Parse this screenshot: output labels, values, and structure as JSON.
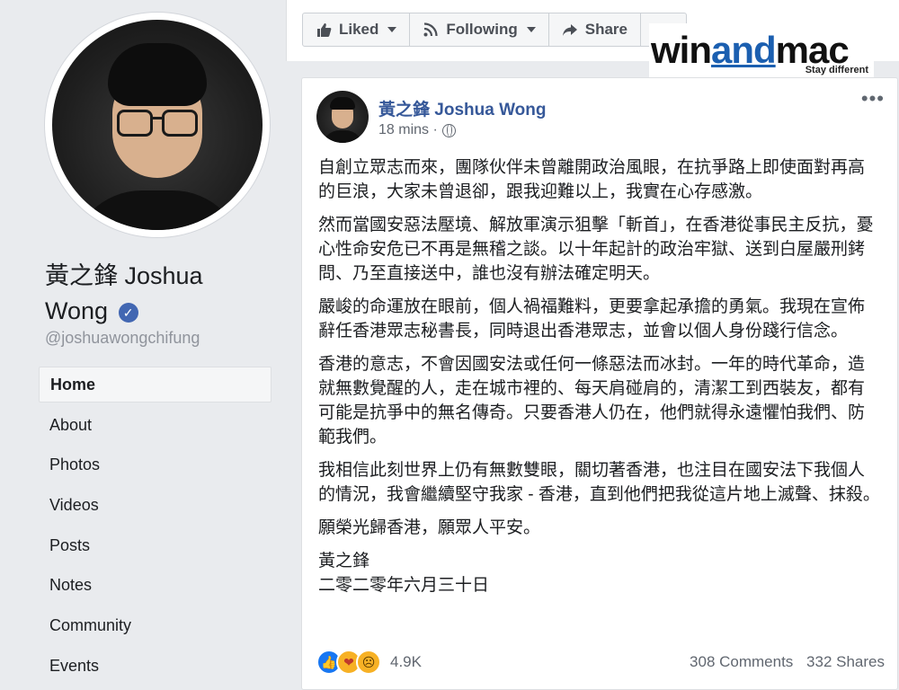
{
  "colors": {
    "link": "#365899",
    "brand": "#4267b2",
    "accent": "#1b5fb0"
  },
  "profile": {
    "name_line1": "黃之鋒 Joshua",
    "name_line2": "Wong",
    "verified_icon": "check-badge-icon",
    "handle": "@joshuawongchifung"
  },
  "nav": {
    "items": [
      {
        "label": "Home",
        "active": true
      },
      {
        "label": "About"
      },
      {
        "label": "Photos"
      },
      {
        "label": "Videos"
      },
      {
        "label": "Posts"
      },
      {
        "label": "Notes"
      },
      {
        "label": "Community"
      },
      {
        "label": "Events"
      }
    ]
  },
  "actions": {
    "liked": "Liked",
    "following": "Following",
    "share": "Share"
  },
  "watermark": {
    "part1": "win",
    "part2": "and",
    "part3": "mac",
    "tagline": "Stay different"
  },
  "post": {
    "author": "黃之鋒 Joshua Wong",
    "time": "18 mins ·",
    "paragraphs": [
      "自創立眾志而來，團隊伙伴未曾離開政治風眼，在抗爭路上即使面對再高的巨浪，大家未曾退卻，跟我迎難以上，我實在心存感激。",
      "然而當國安惡法壓境、解放軍演示狙擊「斬首」，在香港從事民主反抗，憂心性命安危已不再是無稽之談。以十年起計的政治牢獄、送到白屋嚴刑銬問、乃至直接送中，誰也沒有辦法確定明天。",
      "嚴峻的命運放在眼前，個人禍福難料，更要拿起承擔的勇氣。我現在宣佈辭任香港眾志秘書長，同時退出香港眾志，並會以個人身份踐行信念。",
      "香港的意志，不會因國安法或任何一條惡法而冰封。一年的時代革命，造就無數覺醒的人，走在城市裡的、每天肩碰肩的，清潔工到西裝友，都有可能是抗爭中的無名傳奇。只要香港人仍在，他們就得永遠懼怕我們、防範我們。",
      "我相信此刻世界上仍有無數雙眼，關切著香港，也注目在國安法下我個人的情況，我會繼續堅守我家 - 香港，直到他們把我從這片地上滅聲、抹殺。",
      "願榮光歸香港，願眾人平安。"
    ],
    "signature_name": "黃之鋒",
    "signature_date": "二零二零年六月三十日",
    "reaction_count": "4.9K",
    "comments": "308 Comments",
    "shares": "332 Shares"
  }
}
